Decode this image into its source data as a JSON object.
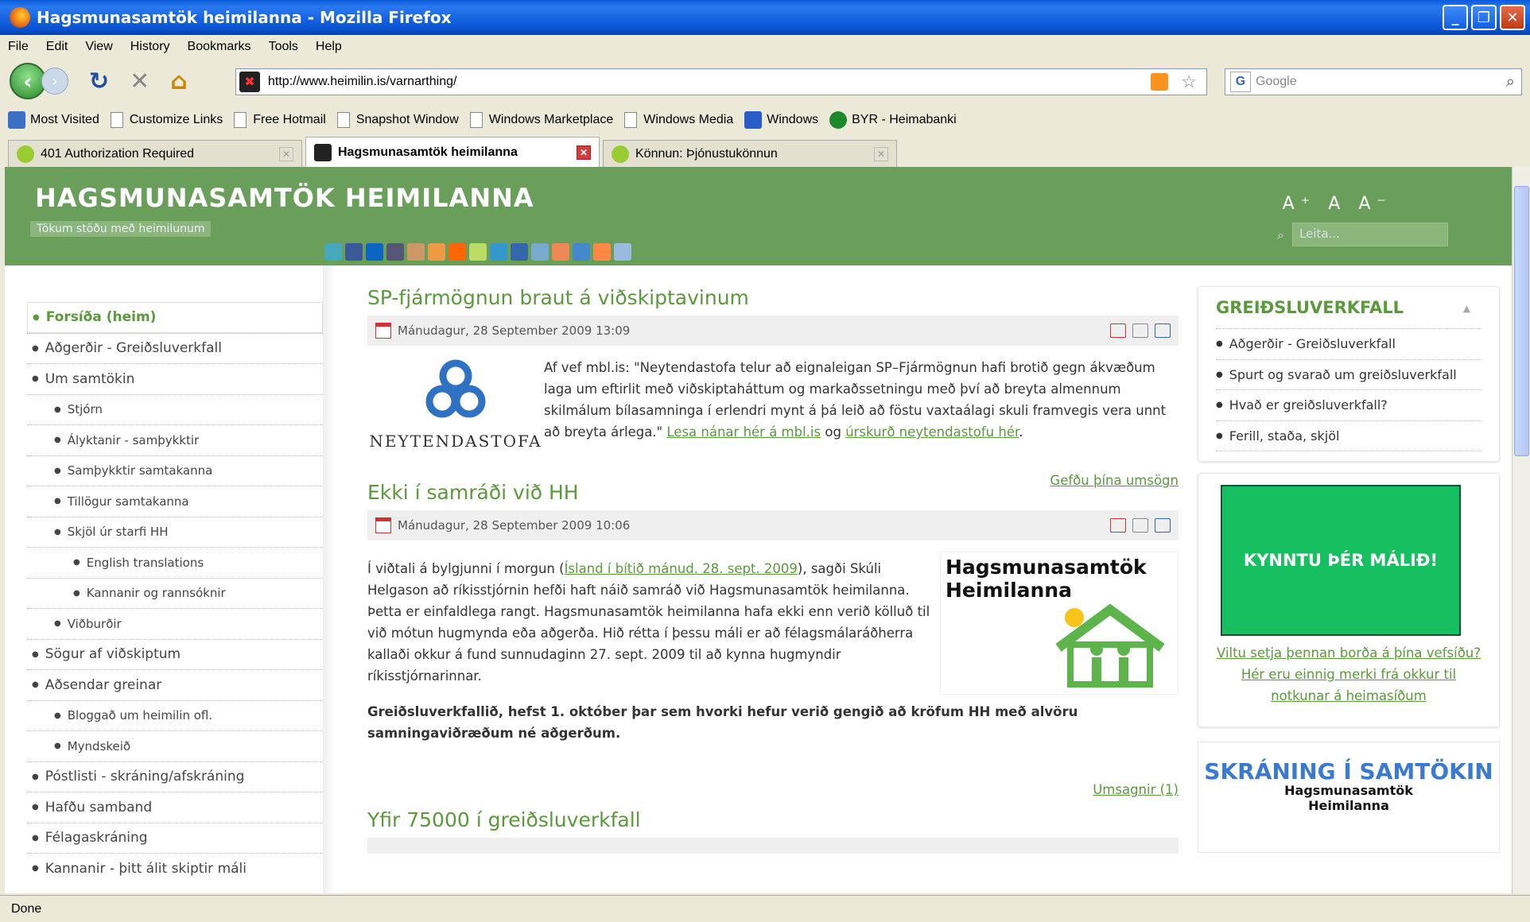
{
  "window": {
    "title": "Hagsmunasamtök heimilanna - Mozilla Firefox",
    "min": "_",
    "max": "❐",
    "close": "✕"
  },
  "menu": [
    "File",
    "Edit",
    "View",
    "History",
    "Bookmarks",
    "Tools",
    "Help"
  ],
  "nav": {
    "url": "http://www.heimilin.is/varnarthing/",
    "search_placeholder": "Google"
  },
  "bookmarks": [
    "Most Visited",
    "Customize Links",
    "Free Hotmail",
    "Snapshot Window",
    "Windows Marketplace",
    "Windows Media",
    "Windows",
    "BYR - Heimabanki"
  ],
  "tabs": [
    "401 Authorization Required",
    "Hagsmunasamtök heimilanna",
    "Könnun: Þjónustukönnun"
  ],
  "status": "Done",
  "site": {
    "title": "HAGSMUNASAMTÖK HEIMILANNA",
    "tagline": "Tökum stöðu með heimilunum",
    "font_sizes": "A⁺ A A⁻",
    "search_placeholder": "Leita..."
  },
  "leftnav": [
    {
      "label": "Forsíða (heim)",
      "level": 1,
      "active": true
    },
    {
      "label": "Aðgerðir - Greiðsluverkfall",
      "level": 1
    },
    {
      "label": "Um samtökin",
      "level": 1
    },
    {
      "label": "Stjórn",
      "level": 2
    },
    {
      "label": "Ályktanir - samþykktir",
      "level": 2
    },
    {
      "label": "Samþykktir samtakanna",
      "level": 2
    },
    {
      "label": "Tillögur samtakanna",
      "level": 2
    },
    {
      "label": "Skjöl úr starfi HH",
      "level": 2
    },
    {
      "label": "English translations",
      "level": 3
    },
    {
      "label": "Kannanir og rannsóknir",
      "level": 3
    },
    {
      "label": "Viðburðir",
      "level": 2
    },
    {
      "label": "Sögur af viðskiptum",
      "level": 1
    },
    {
      "label": "Aðsendar greinar",
      "level": 1
    },
    {
      "label": "Bloggað um heimilin ofl.",
      "level": 2
    },
    {
      "label": "Myndskeið",
      "level": 2
    },
    {
      "label": "Póstlisti - skráning/afskráning",
      "level": 1
    },
    {
      "label": "Hafðu samband",
      "level": 1
    },
    {
      "label": "Félagaskráning",
      "level": 1
    },
    {
      "label": "Kannanir - þitt álit skiptir máli",
      "level": 1
    }
  ],
  "articles": {
    "a1": {
      "title": "SP-fjármögnun braut á viðskiptavinum",
      "date": "Mánudagur, 28 September 2009 13:09",
      "logo_text": "NEYTENDASTOFA",
      "text": "Af vef mbl.is: \"Neytendastofa telur að eignaleigan SP–Fjármögnun hafi brotið gegn ákvæðum laga um eftirlit með viðskiptaháttum og markaðssetningu með því að breyta almennum skilmálum bílasamninga í erlendri mynt á þá leið að föstu vaxtaálagi skuli framvegis vera unnt að breyta árlega.\" ",
      "link1": "Lesa nánar hér á mbl.is",
      "og": " og ",
      "link2": "úrskurð neytendastofu hér",
      "end": "."
    },
    "a2": {
      "title": "Ekki í samráði við HH",
      "comment_link": "Gefðu þína umsögn",
      "date": "Mánudagur, 28 September 2009 10:06",
      "p1a": "Í viðtali á bylgjunni í morgun (",
      "p1link": "Ísland í bítið mánud. 28. sept. 2009",
      "p1b": "), sagði Skúli Helgason að ríkisstjórnin hefði haft náið samráð við Hagsmunasamtök heimilanna. Þetta er einfaldlega rangt. Hagsmunasamtök heimilanna hafa ekki enn verið kölluð til við mótun hugmynda eða aðgerða. Hið rétta í þessu máli er að félagsmálaráðherra kallaði okkur á fund sunnudaginn 27. sept. 2009 til að kynna hugmyndir ríkisstjórnarinnar.",
      "p2": "Greiðsluverkfallið, hefst 1. október þar sem hvorki hefur verið gengið að kröfum HH með alvöru samningaviðræðum né aðgerðum.",
      "logo_l1": "Hagsmunasamtök",
      "logo_l2": "Heimilanna",
      "comments": "Umsagnir (1)"
    },
    "a3": {
      "title": "Yfir 75000 í greiðsluverkfall"
    }
  },
  "right": {
    "box_title": "GREIÐSLUVERKFALL",
    "box_arrow": "▲",
    "items": [
      "Aðgerðir - Greiðsluverkfall",
      "Spurt og svarað um greiðsluverkfall",
      "Hvað er greiðsluverkfall?",
      "Ferill, staða, skjöl"
    ],
    "banner_text": "KYNNTU ÞÉR MÁLIÐ!",
    "banner_link1": "Viltu setja þennan borða á þína vefsíðu?",
    "banner_link2": "Hér eru einnig merki frá okkur til notkunar á heimasíðum",
    "signup_title": "SKRÁNING Í SAMTÖKIN",
    "signup_logo1": "Hagsmunasamtök",
    "signup_logo2": "Heimilanna"
  }
}
